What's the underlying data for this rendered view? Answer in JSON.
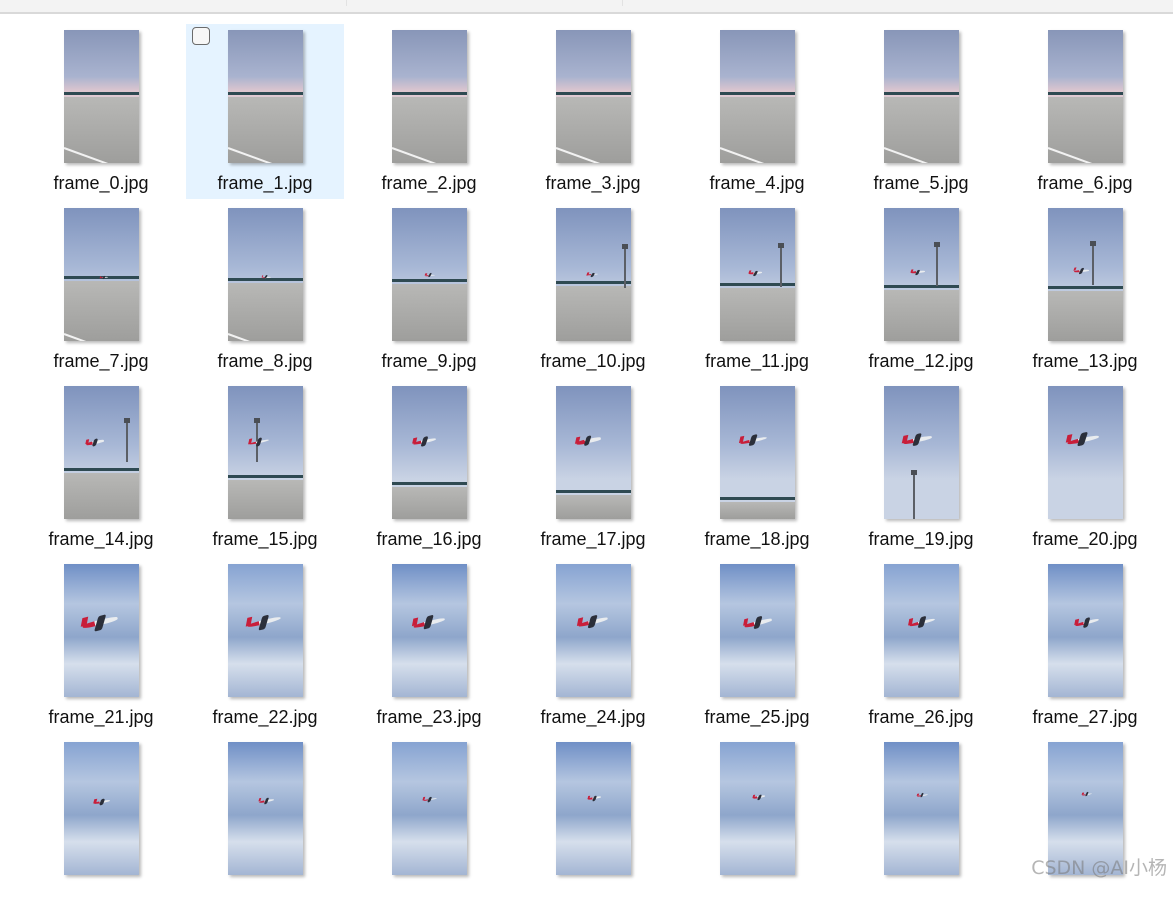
{
  "files": [
    {
      "name": "frame_0.jpg"
    },
    {
      "name": "frame_1.jpg",
      "selected": true
    },
    {
      "name": "frame_2.jpg"
    },
    {
      "name": "frame_3.jpg"
    },
    {
      "name": "frame_4.jpg"
    },
    {
      "name": "frame_5.jpg"
    },
    {
      "name": "frame_6.jpg"
    },
    {
      "name": "frame_7.jpg"
    },
    {
      "name": "frame_8.jpg"
    },
    {
      "name": "frame_9.jpg"
    },
    {
      "name": "frame_10.jpg"
    },
    {
      "name": "frame_11.jpg"
    },
    {
      "name": "frame_12.jpg"
    },
    {
      "name": "frame_13.jpg"
    },
    {
      "name": "frame_14.jpg"
    },
    {
      "name": "frame_15.jpg"
    },
    {
      "name": "frame_16.jpg"
    },
    {
      "name": "frame_17.jpg"
    },
    {
      "name": "frame_18.jpg"
    },
    {
      "name": "frame_19.jpg"
    },
    {
      "name": "frame_20.jpg"
    },
    {
      "name": "frame_21.jpg"
    },
    {
      "name": "frame_22.jpg"
    },
    {
      "name": "frame_23.jpg"
    },
    {
      "name": "frame_24.jpg"
    },
    {
      "name": "frame_25.jpg"
    },
    {
      "name": "frame_26.jpg"
    },
    {
      "name": "frame_27.jpg"
    },
    {
      "name": ""
    },
    {
      "name": ""
    },
    {
      "name": ""
    },
    {
      "name": ""
    },
    {
      "name": ""
    },
    {
      "name": ""
    },
    {
      "name": ""
    }
  ],
  "watermark": "CSDN @AI小杨",
  "colors": {
    "selection": "#e5f3ff",
    "plane_livery": "#c81e3a"
  }
}
